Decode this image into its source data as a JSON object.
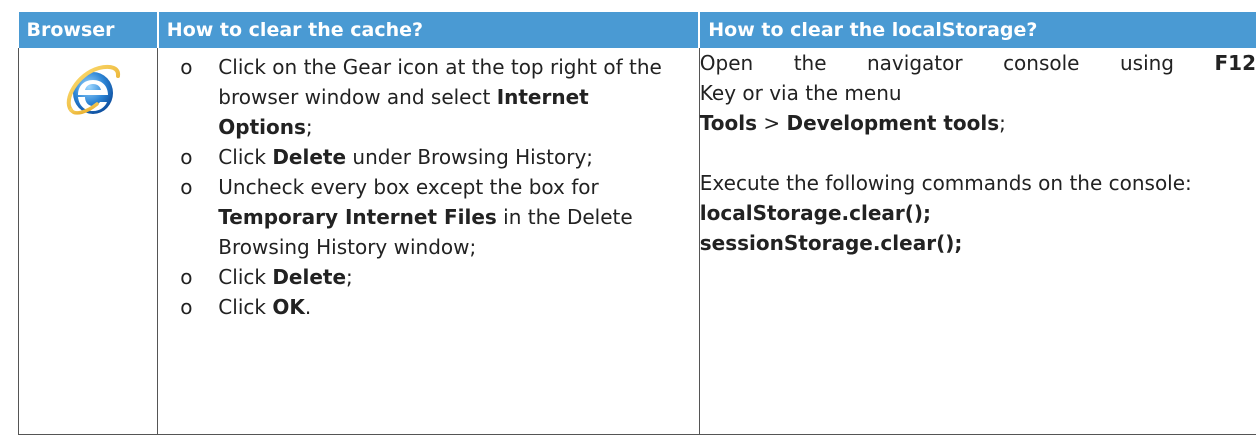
{
  "table": {
    "headers": [
      "Browser",
      "How to clear the cache?",
      "How to clear the localStorage?"
    ],
    "browser_icon": "internet-explorer-icon",
    "cache_steps": [
      {
        "parts": [
          {
            "t": "Click on the Gear icon at the top right of the browser window and select "
          },
          {
            "b": "Internet Options"
          },
          {
            "t": ";"
          }
        ]
      },
      {
        "parts": [
          {
            "t": "Click "
          },
          {
            "b": "Delete"
          },
          {
            "t": " under Browsing History;"
          }
        ]
      },
      {
        "parts": [
          {
            "t": "Uncheck every box except the box for "
          },
          {
            "b": "Temporary Internet Files"
          },
          {
            "t": " in the Delete Browsing History window;"
          }
        ]
      },
      {
        "parts": [
          {
            "t": "Click "
          },
          {
            "b": "Delete"
          },
          {
            "t": ";"
          }
        ]
      },
      {
        "parts": [
          {
            "t": "Click "
          },
          {
            "b": "OK"
          },
          {
            "t": "."
          }
        ]
      }
    ],
    "bullet_char": "o",
    "localstorage": {
      "intro_a": "Open the navigator console using",
      "intro_key": "F12",
      "intro_b": "Key or via the menu",
      "menu_tools": "Tools",
      "menu_sep": " > ",
      "menu_dev": "Development tools",
      "menu_end": ";",
      "exec_text": "Execute the following commands on the console:",
      "cmd1": "localStorage.clear();",
      "cmd2": "sessionStorage.clear();"
    }
  }
}
